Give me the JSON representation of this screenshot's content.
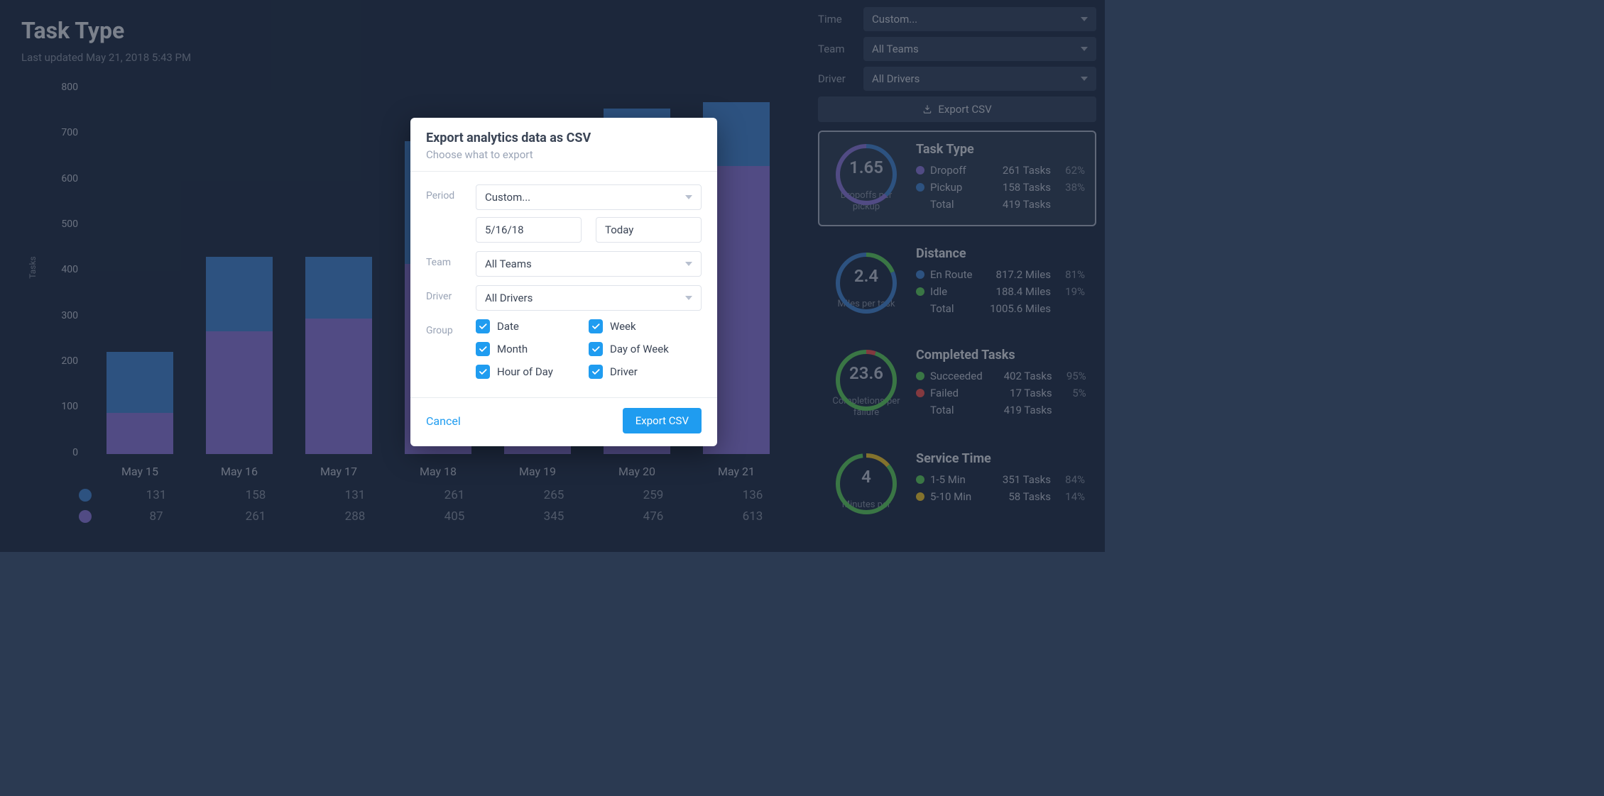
{
  "pageTitle": "Task Type",
  "lastUpdated": "Last updated May 21, 2018 5:43 PM",
  "chart_data": {
    "type": "bar",
    "ylabel": "Tasks",
    "ylim": [
      0,
      800
    ],
    "yticks": [
      0,
      100,
      200,
      300,
      400,
      500,
      600,
      700,
      800
    ],
    "categories": [
      "May 15",
      "May 16",
      "May 17",
      "May 18",
      "May 19",
      "May 20",
      "May 21"
    ],
    "series": [
      {
        "name": "Pickup",
        "color": "#4a88d0",
        "values": [
          131,
          158,
          131,
          261,
          265,
          259,
          136
        ]
      },
      {
        "name": "Dropoff",
        "color": "#8b7bd8",
        "values": [
          87,
          261,
          288,
          405,
          345,
          476,
          613
        ]
      }
    ]
  },
  "tableRows": {
    "row0": {
      "c0": "131",
      "c1": "158",
      "c2": "131",
      "c3": "261",
      "c4": "265",
      "c5": "259",
      "c6": "136"
    },
    "row1": {
      "c0": "87",
      "c1": "261",
      "c2": "288",
      "c3": "405",
      "c4": "345",
      "c5": "476",
      "c6": "613"
    }
  },
  "filters": {
    "timeLabel": "Time",
    "timeValue": "Custom...",
    "teamLabel": "Team",
    "teamValue": "All Teams",
    "driverLabel": "Driver",
    "driverValue": "All Drivers",
    "exportLabel": "Export CSV"
  },
  "cards": {
    "taskType": {
      "ringValue": "1.65",
      "ringSub": "Dropoffs per pickup",
      "title": "Task Type",
      "rows": {
        "r0": {
          "label": "Dropoff",
          "val": "261 Tasks",
          "pct": "62%"
        },
        "r1": {
          "label": "Pickup",
          "val": "158 Tasks",
          "pct": "38%"
        }
      },
      "totalLabel": "Total",
      "totalVal": "419 Tasks"
    },
    "distance": {
      "ringValue": "2.4",
      "ringSub": "Miles per task",
      "title": "Distance",
      "rows": {
        "r0": {
          "label": "En Route",
          "val": "817.2 Miles",
          "pct": "81%"
        },
        "r1": {
          "label": "Idle",
          "val": "188.4 Miles",
          "pct": "19%"
        }
      },
      "totalLabel": "Total",
      "totalVal": "1005.6 Miles"
    },
    "completed": {
      "ringValue": "23.6",
      "ringSub": "Completions per failure",
      "title": "Completed Tasks",
      "rows": {
        "r0": {
          "label": "Succeeded",
          "val": "402 Tasks",
          "pct": "95%"
        },
        "r1": {
          "label": "Failed",
          "val": "17 Tasks",
          "pct": "5%"
        }
      },
      "totalLabel": "Total",
      "totalVal": "419 Tasks"
    },
    "service": {
      "ringValue": "4",
      "ringSub": "Minutes per",
      "title": "Service Time",
      "rows": {
        "r0": {
          "label": "1-5 Min",
          "val": "351 Tasks",
          "pct": "84%"
        },
        "r1": {
          "label": "5-10 Min",
          "val": "58 Tasks",
          "pct": "14%"
        }
      }
    }
  },
  "modal": {
    "title": "Export analytics data as CSV",
    "sub": "Choose what to export",
    "periodLabel": "Period",
    "periodValue": "Custom...",
    "dateFrom": "5/16/18",
    "dateTo": "Today",
    "teamLabel": "Team",
    "teamValue": "All Teams",
    "driverLabel": "Driver",
    "driverValue": "All Drivers",
    "groupLabel": "Group",
    "checks": {
      "c0": "Date",
      "c1": "Week",
      "c2": "Month",
      "c3": "Day of Week",
      "c4": "Hour of Day",
      "c5": "Driver"
    },
    "cancel": "Cancel",
    "submit": "Export CSV"
  }
}
